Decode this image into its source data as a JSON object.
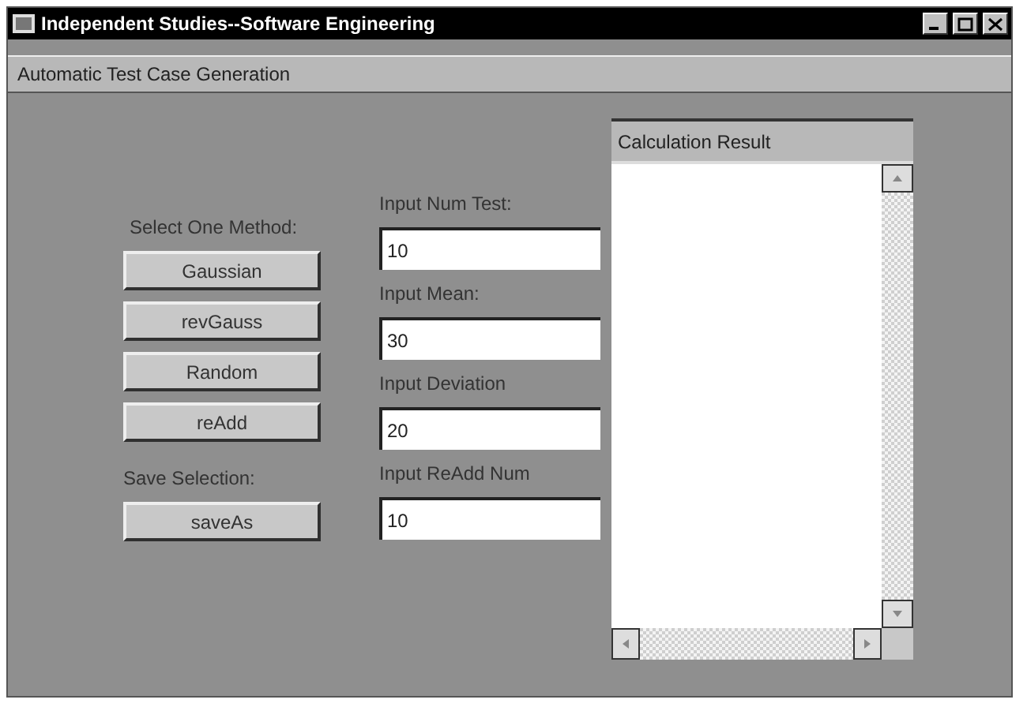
{
  "window": {
    "title": "Independent Studies--Software Engineering"
  },
  "header": "Automatic Test Case Generation",
  "method_label": "Select One Method:",
  "method_buttons": [
    "Gaussian",
    "revGauss",
    "Random",
    "reAdd"
  ],
  "save_label": "Save Selection:",
  "save_button": "saveAs",
  "inputs": [
    {
      "label": "Input Num Test:",
      "value": "10"
    },
    {
      "label": "Input Mean:",
      "value": "30"
    },
    {
      "label": "Input Deviation",
      "value": "20"
    },
    {
      "label": "Input ReAdd Num",
      "value": "10"
    }
  ],
  "result_panel": {
    "title": "Calculation Result"
  }
}
